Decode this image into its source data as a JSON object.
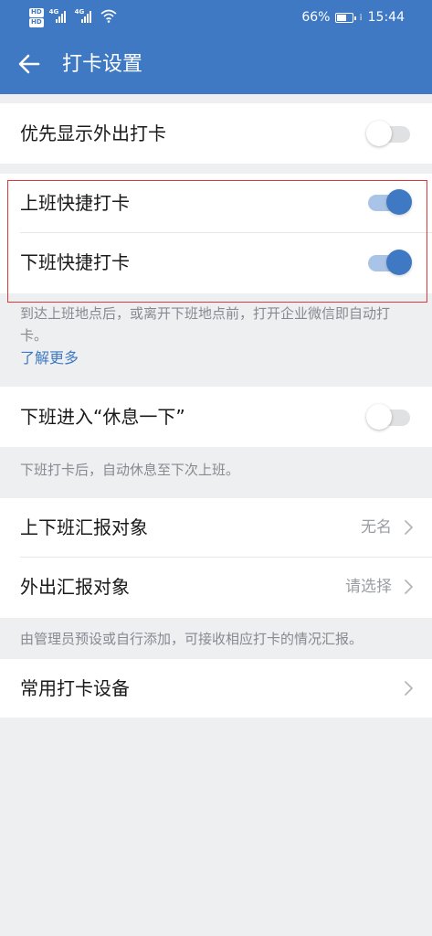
{
  "status_bar": {
    "hd_badges": [
      "HD",
      "HD"
    ],
    "signal_labels": [
      "4G",
      "4G"
    ],
    "battery_text": "66%",
    "battery_level": 0.66,
    "time": "15:44"
  },
  "header": {
    "title": "打卡设置",
    "back_icon": "arrow-left-icon"
  },
  "settings": {
    "show_outing_first": {
      "label": "优先显示外出打卡",
      "enabled": false
    },
    "quick_clock_in": {
      "label": "上班快捷打卡",
      "enabled": true
    },
    "quick_clock_out": {
      "label": "下班快捷打卡",
      "enabled": true
    },
    "quick_note": "到达上班地点后，或离开下班地点前，打开企业微信即自动打卡。",
    "learn_more": "了解更多",
    "rest_mode": {
      "label": "下班进入“休息一下”",
      "enabled": false
    },
    "rest_note": "下班打卡后，自动休息至下次上班。",
    "report_work": {
      "label": "上下班汇报对象",
      "value": "无名"
    },
    "report_outing": {
      "label": "外出汇报对象",
      "value": "请选择"
    },
    "report_note": "由管理员预设或自行添加，可接收相应打卡的情况汇报。",
    "devices": {
      "label": "常用打卡设备"
    }
  },
  "colors": {
    "header": "#3f79c4",
    "accent": "#3f79c4",
    "highlight_border": "#e1373c",
    "background": "#eeeff1"
  }
}
